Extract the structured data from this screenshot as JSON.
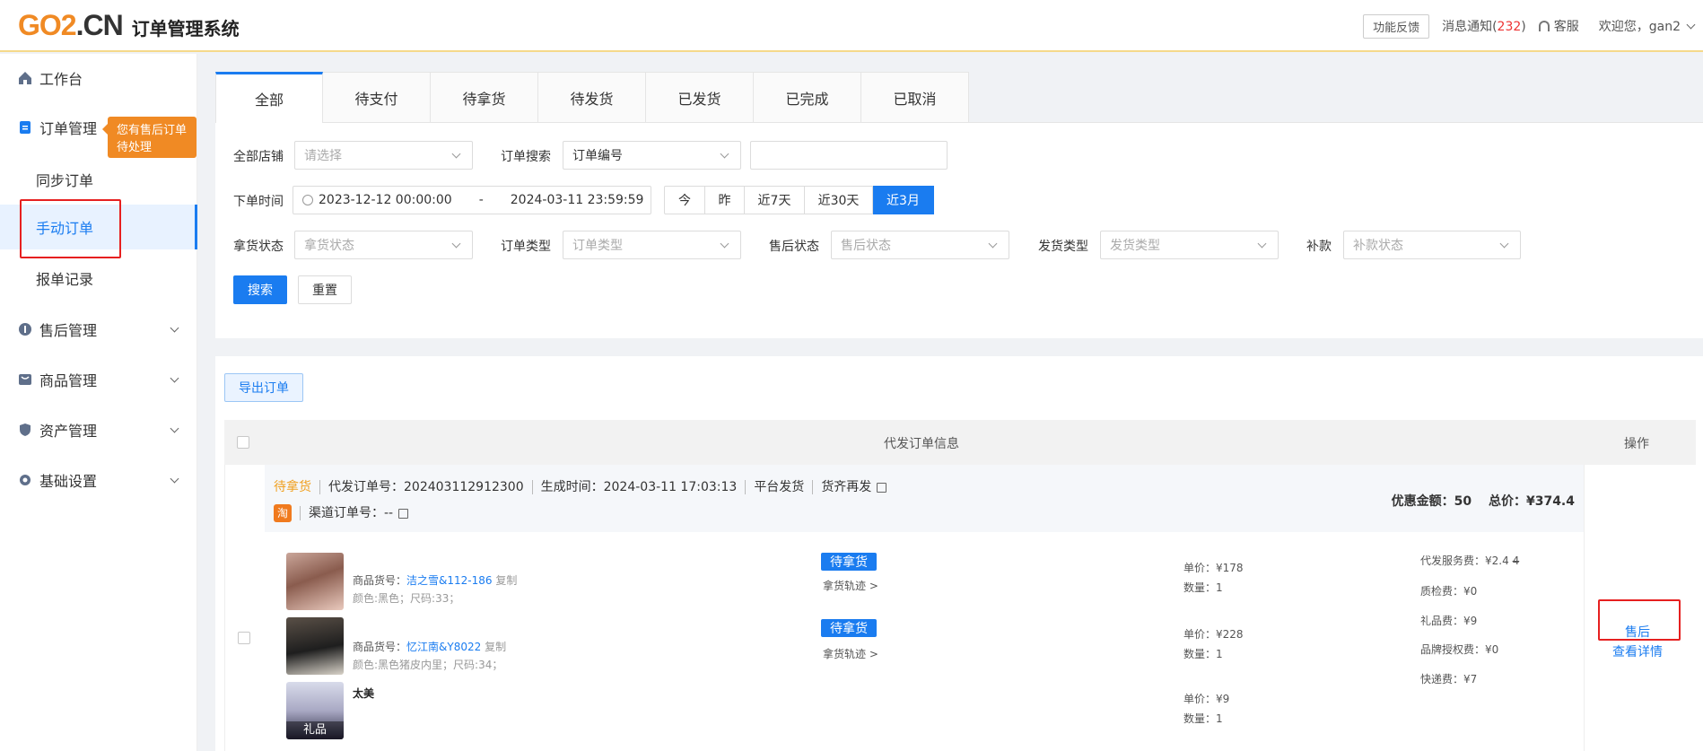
{
  "header": {
    "logo_go": "GO2",
    "logo_dot_cn": ".CN",
    "logo_title": "订单管理系统",
    "feedback": "功能反馈",
    "msg_label": "消息通知(",
    "msg_count": "232",
    "msg_close": ")",
    "service": "客服",
    "welcome": "欢迎您，gan2"
  },
  "sidebar": {
    "workbench": "工作台",
    "order_mgmt": "订单管理",
    "tip": "您有售后订单待处理",
    "sync_order": "同步订单",
    "manual_order": "手动订单",
    "report_record": "报单记录",
    "aftersale_mgmt": "售后管理",
    "product_mgmt": "商品管理",
    "asset_mgmt": "资产管理",
    "base_settings": "基础设置"
  },
  "tabs": [
    "全部",
    "待支付",
    "待拿货",
    "待发货",
    "已发货",
    "已完成",
    "已取消"
  ],
  "filters": {
    "store_label": "全部店铺",
    "store_placeholder": "请选择",
    "search_label": "订单搜索",
    "search_type": "订单编号",
    "time_label": "下单时间",
    "start_time": "2023-12-12 00:00:00",
    "range_sep": "-",
    "end_time": "2024-03-11 23:59:59",
    "quick": [
      "今",
      "昨",
      "近7天",
      "近30天",
      "近3月"
    ],
    "pickup_label": "拿货状态",
    "pickup_placeholder": "拿货状态",
    "ordertype_label": "订单类型",
    "ordertype_placeholder": "订单类型",
    "aftersale_label": "售后状态",
    "aftersale_placeholder": "售后状态",
    "shiptype_label": "发货类型",
    "shiptype_placeholder": "发货类型",
    "refund_label": "补款",
    "refund_placeholder": "补款状态",
    "search_btn": "搜索",
    "reset_btn": "重置"
  },
  "list": {
    "export_btn": "导出订单",
    "col_info": "代发订单信息",
    "col_ops": "操作"
  },
  "order": {
    "status": "待拿货",
    "order_no": "代发订单号：202403112912300",
    "created": "生成时间：2024-03-11 17:03:13",
    "platform": "平台发货",
    "resend": "货齐再发",
    "tao": "淘",
    "channel_no": "渠道订单号：--",
    "discount_label": "优惠金额：",
    "discount": "50",
    "total_label": "总价：",
    "total": "¥374.4",
    "items": [
      {
        "sku_label": "商品货号：",
        "sku": "洁之雪&112-186",
        "copy": "复制",
        "spec": "颜色:黑色；尺码:33；",
        "badge": "待拿货",
        "track": "拿货轨迹 >",
        "price": "单价：¥178",
        "qty": "数量：1"
      },
      {
        "sku_label": "商品货号：",
        "sku": "忆江南&Y8022",
        "copy": "复制",
        "spec": "颜色:黑色猪皮内里；尺码:34；",
        "badge": "待拿货",
        "track": "拿货轨迹 >",
        "price": "单价：¥228",
        "qty": "数量：1"
      },
      {
        "name": "太美",
        "gift_tag": "礼品",
        "price": "单价：¥9",
        "qty": "数量：1"
      }
    ],
    "fees": [
      {
        "label": "代发服务费：",
        "value": "¥2.4",
        "strike": "4"
      },
      {
        "label": "质检费：",
        "value": "¥0"
      },
      {
        "label": "礼品费：",
        "value": "¥9"
      },
      {
        "label": "品牌授权费：",
        "value": "¥0"
      },
      {
        "label": "快递费：",
        "value": "¥7"
      }
    ],
    "op_aftersale": "售后",
    "op_detail": "查看详情"
  }
}
